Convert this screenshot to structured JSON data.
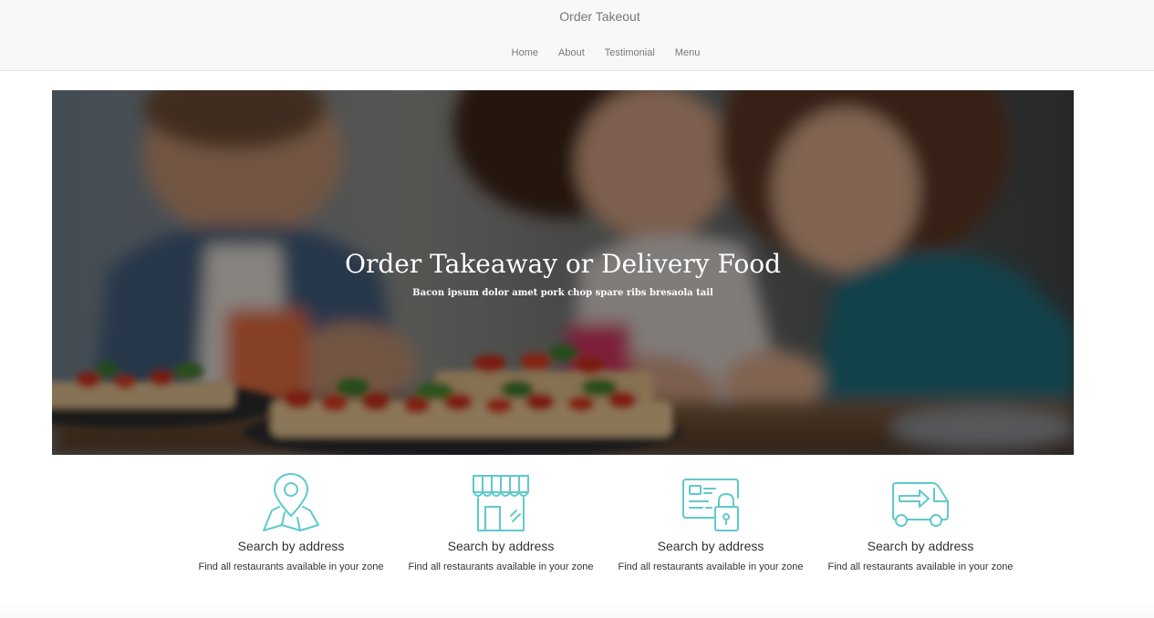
{
  "navbar": {
    "brand": "Order Takeout",
    "links": [
      {
        "label": "Home"
      },
      {
        "label": "About"
      },
      {
        "label": "Testimonial"
      },
      {
        "label": "Menu"
      }
    ]
  },
  "hero": {
    "title": "Order Takeaway or Delivery Food",
    "subtitle": "Bacon ipsum dolor amet pork chop spare ribs bresaola tail"
  },
  "features": [
    {
      "icon": "map-pin-icon",
      "title": "Search by address",
      "description": "Find all restaurants available in your zone"
    },
    {
      "icon": "storefront-icon",
      "title": "Search by address",
      "description": "Find all restaurants available in your zone"
    },
    {
      "icon": "secure-card-icon",
      "title": "Search by address",
      "description": "Find all restaurants available in your zone"
    },
    {
      "icon": "delivery-van-icon",
      "title": "Search by address",
      "description": "Find all restaurants available in your zone"
    }
  ],
  "colors": {
    "accent": "#5fc9cc",
    "navbar_bg": "#f8f8f8",
    "nav_text": "#777777",
    "body_text": "#333333"
  }
}
